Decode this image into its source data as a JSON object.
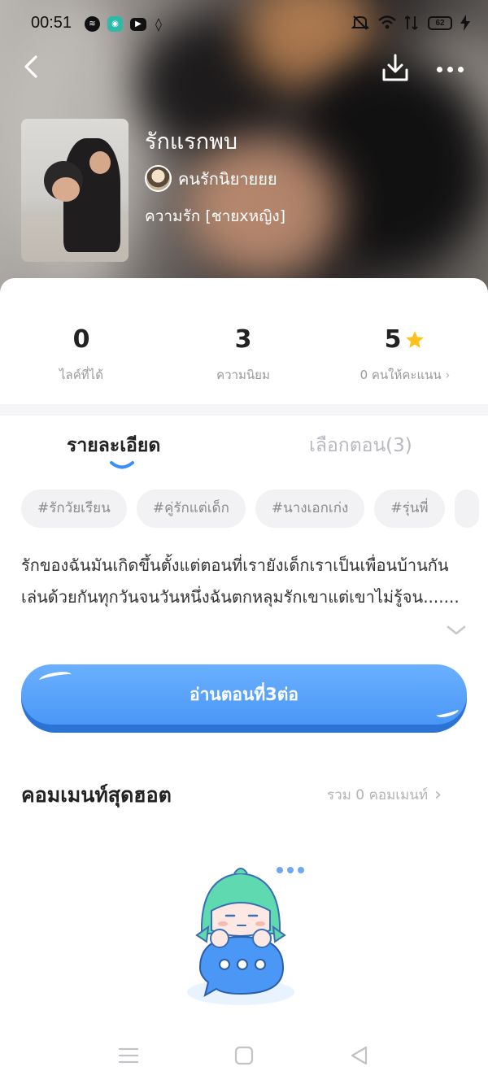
{
  "status_bar": {
    "time": "00:51",
    "battery": "62",
    "app_icons": [
      "spotify-icon",
      "line-icon",
      "youtube-icon",
      "tinder-icon"
    ],
    "system_icons": [
      "mute-icon",
      "wifi-icon",
      "signal-icon",
      "battery-icon",
      "charging-icon"
    ]
  },
  "header": {
    "back": "chevron-left-icon",
    "download": "download-icon",
    "more": "more-icon"
  },
  "book": {
    "title": "รักแรกพบ",
    "author": "คนรักนิยายยย",
    "genre": "ความรัก [ชายxหญิง]"
  },
  "stats": [
    {
      "value": "0",
      "label": "ไลค์ที่ได้"
    },
    {
      "value": "3",
      "label": "ความนิยม"
    },
    {
      "value": "5",
      "label": "0 คนให้คะแนน"
    }
  ],
  "tabs": {
    "detail": "รายละเอียด",
    "chapters": "เลือกตอน(3)",
    "active": "detail"
  },
  "tags": [
    "#รักวัยเรียน",
    "#คู่รักแต่เด็ก",
    "#นางเอกเก่ง",
    "#รุ่นพี่"
  ],
  "description": "รักของฉันมันเกิดขึ้นตั้งแต่ตอนที่เรายังเด็กเราเป็นเพื่อนบ้านกันเล่นด้วยกันทุกวันจนวันหนึ่งฉันตกหลุมรักเขาแต่เขาไม่รู้จน.......",
  "read_button": "อ่านตอนที่3ต่อ",
  "comments": {
    "title": "คอมเมนท์สุดฮอต",
    "total": "รวม 0 คอมเมนท์"
  },
  "colors": {
    "accent": "#4a97f6",
    "star": "#ffc21a",
    "mascot_hair": "#5fd9b0"
  }
}
